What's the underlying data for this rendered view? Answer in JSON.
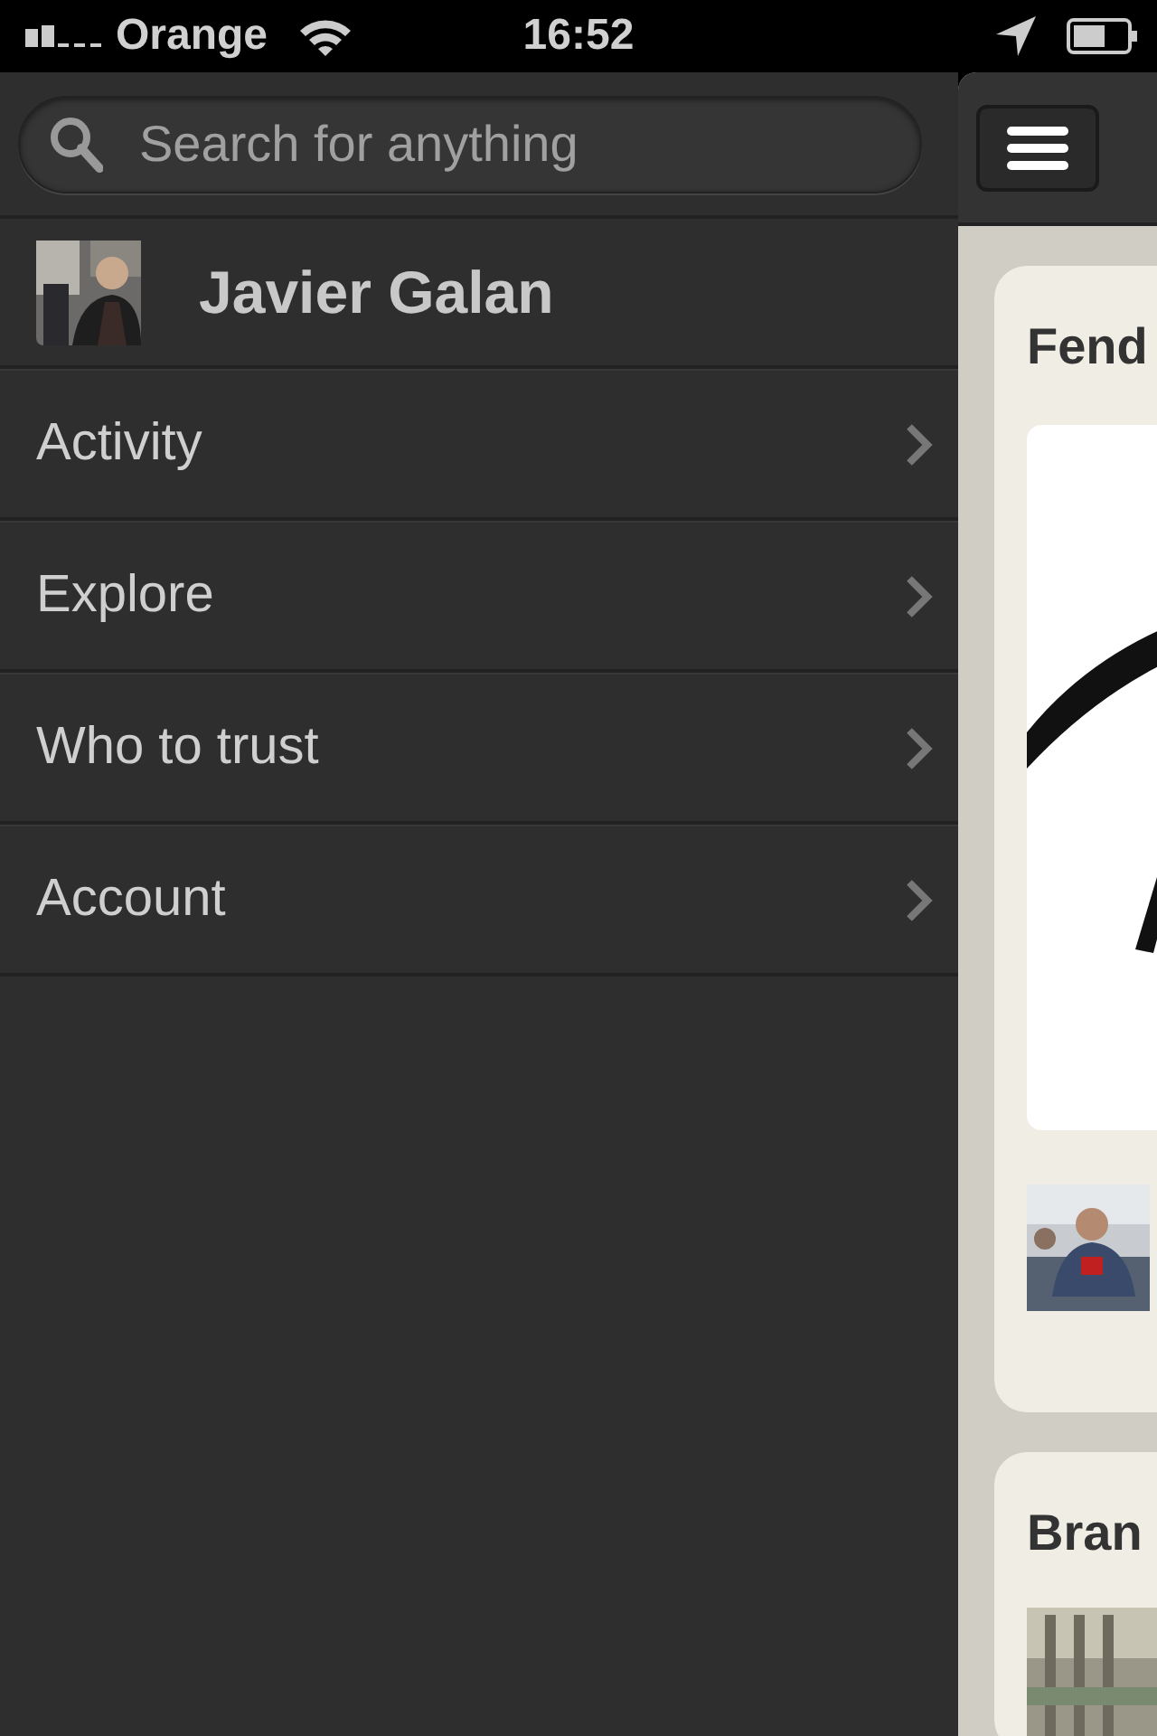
{
  "status_bar": {
    "carrier": "Orange",
    "time": "16:52"
  },
  "sidebar": {
    "search": {
      "placeholder": "Search for anything"
    },
    "user": {
      "name": "Javier Galan"
    },
    "items": [
      {
        "label": "Activity"
      },
      {
        "label": "Explore"
      },
      {
        "label": "Who to trust"
      },
      {
        "label": "Account"
      }
    ]
  },
  "main": {
    "cards": [
      {
        "title": "Fend"
      },
      {
        "title": "Bran"
      }
    ]
  }
}
